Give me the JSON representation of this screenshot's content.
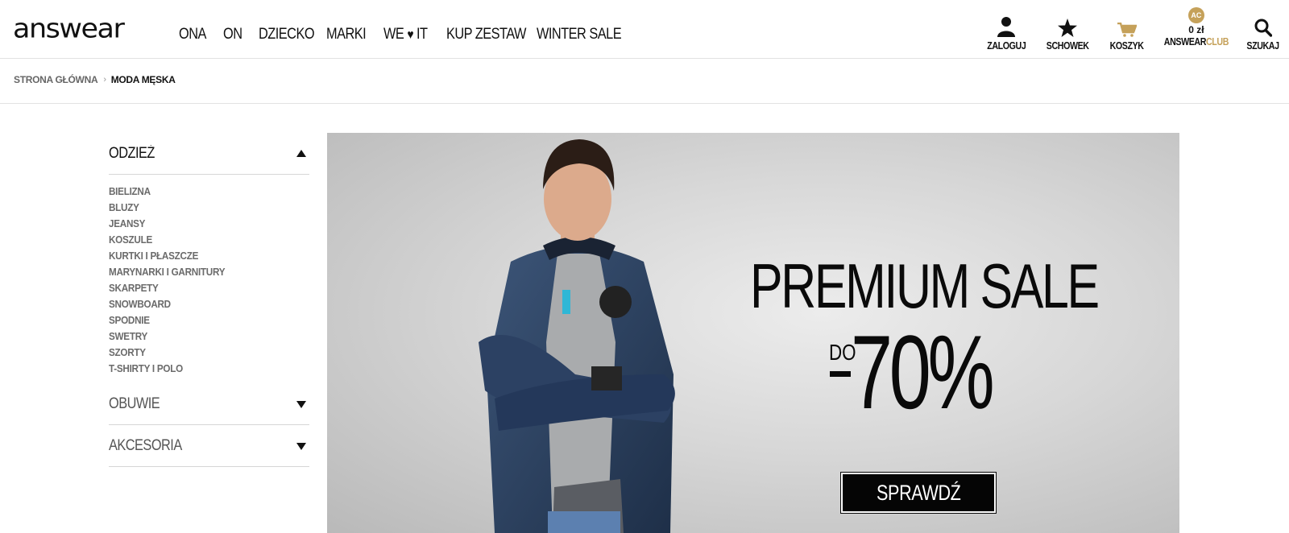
{
  "brand": {
    "logo_text": "answear"
  },
  "nav": {
    "items": [
      "ONA",
      "ON",
      "DZIECKO",
      "MARKI",
      "WE",
      "IT",
      "KUP ZESTAW",
      "WINTER SALE"
    ],
    "heart_symbol": "♥"
  },
  "actions": {
    "login": "ZALOGUJ",
    "wishlist": "SCHOWEK",
    "cart": "KOSZYK",
    "club_badge": "AC",
    "club_amount": "0 zł",
    "club_prefix": "ANSWEAR",
    "club_suffix": "CLUB",
    "search": "SZUKAJ"
  },
  "breadcrumb": {
    "home": "STRONA GŁÓWNA",
    "separator": "›",
    "current": "MODA MĘSKA"
  },
  "sidebar": {
    "categories": [
      {
        "title": "ODZIEŻ",
        "expanded": true,
        "items": [
          "BIELIZNA",
          "BLUZY",
          "JEANSY",
          "KOSZULE",
          "KURTKI I PŁASZCZE",
          "MARYNARKI I GARNITURY",
          "SKARPETY",
          "SNOWBOARD",
          "SPODNIE",
          "SWETRY",
          "SZORTY",
          "T-SHIRTY I POLO"
        ]
      },
      {
        "title": "OBUWIE",
        "expanded": false
      },
      {
        "title": "AKCESORIA",
        "expanded": false
      }
    ]
  },
  "banner": {
    "title": "PREMIUM SALE",
    "prefix": "DO",
    "discount": "-70%",
    "discount_number": "70%",
    "cta": "SPRAWDŹ"
  },
  "colors": {
    "accent_gold": "#c5a15a",
    "text": "#111111",
    "muted": "#6b6b6b",
    "border": "#e2e2e2"
  }
}
